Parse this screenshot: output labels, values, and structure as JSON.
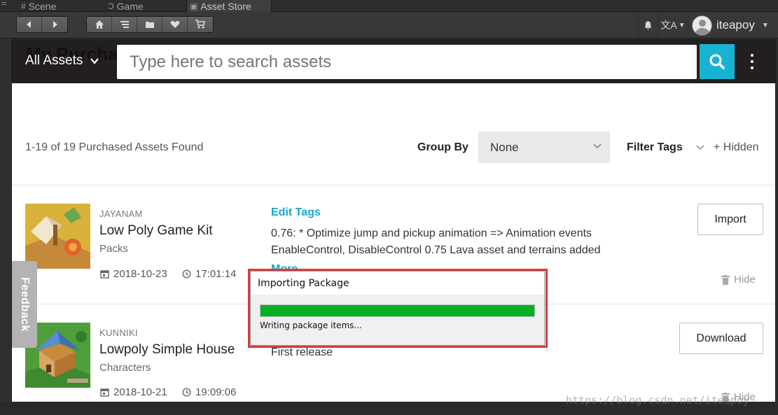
{
  "editor_tabs": [
    {
      "label": "Scene",
      "glyph": "#"
    },
    {
      "label": "Game",
      "glyph": "Ɔ"
    },
    {
      "label": "Asset Store",
      "glyph": "▣"
    }
  ],
  "toolbar": {
    "nav_icons": [
      "arrow-left-icon",
      "arrow-right-icon"
    ],
    "store_icons": [
      "home-icon",
      "list-icon",
      "folder-icon",
      "heart-icon",
      "cart-icon"
    ],
    "lang_glyph": "文A",
    "username": "iteapoy"
  },
  "header": {
    "page_title_ghost": "My Purcha",
    "category": "All Assets",
    "search_placeholder": "Type here to search assets"
  },
  "summary": "1-19 of 19 Purchased Assets Found",
  "group_by": {
    "label": "Group By",
    "value": "None"
  },
  "filter_tags": {
    "label": "Filter Tags",
    "hidden_link": "+ Hidden"
  },
  "assets": [
    {
      "publisher": "JAYANAM",
      "name": "Low Poly Game Kit",
      "category": "Packs",
      "date": "2018-10-23",
      "time": "17:01:14",
      "edit_tags": "Edit Tags",
      "notes_line1": "0.76: * Optimize jump and pickup animation => Animation events",
      "notes_line2": "EnableControl, DisableControl 0.75 Lava asset and terrains added",
      "more": "More",
      "action": "Import",
      "hide": "Hide"
    },
    {
      "publisher": "KUNNIKI",
      "name": "Lowpoly Simple House",
      "category": "Characters",
      "date": "2018-10-21",
      "time": "19:09:06",
      "notes_line1": "First release",
      "action": "Download",
      "hide": "Hide"
    }
  ],
  "feedback": "Feedback",
  "import_dialog": {
    "title": "Importing Package",
    "status": "Writing package items...",
    "progress": 1.0,
    "progress_color": "#06b025"
  },
  "colors": {
    "accent": "#18b3d2",
    "header_bg": "#231f20",
    "highlight": "#d63a3a"
  },
  "watermark": "https://blog.csdn.net/iteapoy"
}
